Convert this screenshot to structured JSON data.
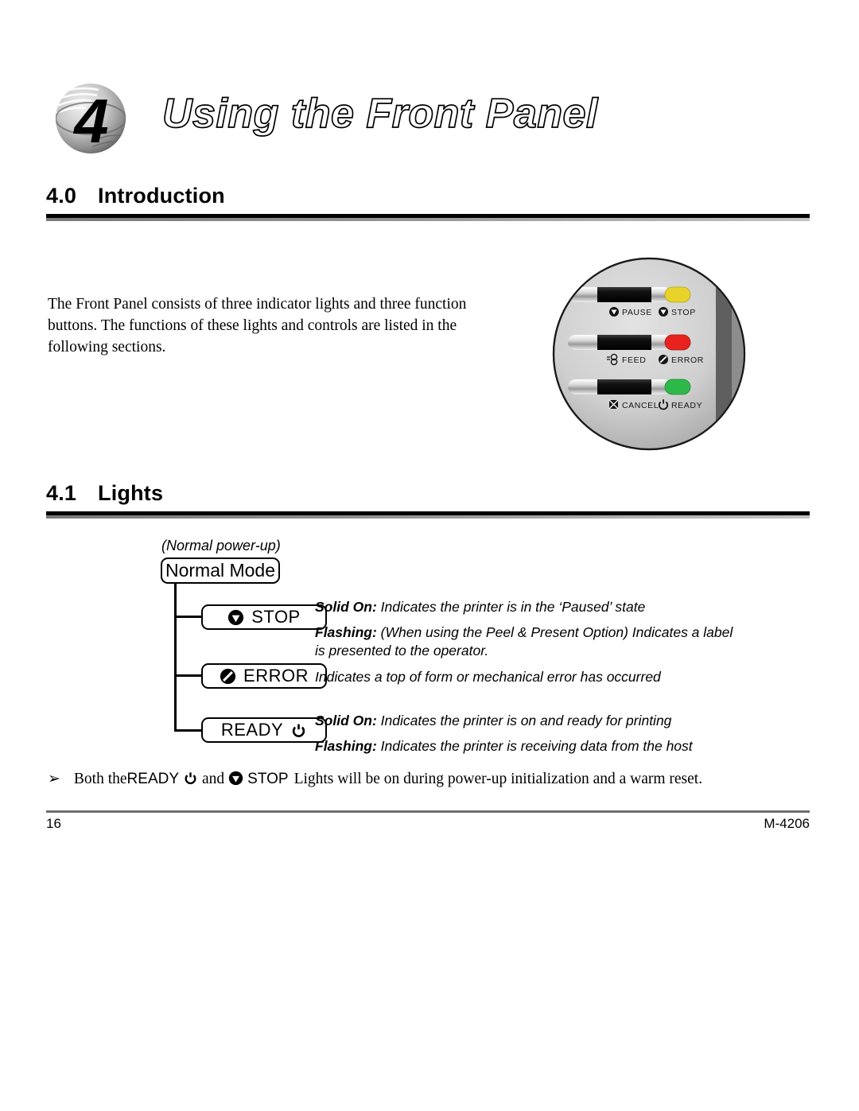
{
  "document": {
    "chapter_number": "4",
    "chapter_title": "Using the Front Panel"
  },
  "sections": {
    "intro": {
      "number": "4.0",
      "title": "Introduction",
      "body": "The Front Panel consists of three indicator lights and three function buttons.  The functions of these lights and controls are listed in the following sections."
    },
    "lights": {
      "number": "4.1",
      "title": "Lights"
    }
  },
  "panel_photo": {
    "buttons": [
      "PAUSE",
      "FEED",
      "CANCEL"
    ],
    "indicators": [
      {
        "label": "STOP",
        "color": "#e8d32a"
      },
      {
        "label": "ERROR",
        "color": "#e8231f"
      },
      {
        "label": "READY",
        "color": "#2fb84a"
      }
    ]
  },
  "diagram": {
    "mode_caption": "(Normal power-up)",
    "mode_label": "Normal Mode",
    "lights": [
      {
        "label": "STOP",
        "icon": "stop-triangle-icon",
        "icon_side": "left",
        "descriptions": [
          {
            "keyword": "Solid On:",
            "text": " Indicates the printer is in the ‘Paused’ state"
          },
          {
            "keyword": "Flashing:",
            "text": " (When using the Peel & Present Option) Indicates a label is presented to the operator."
          }
        ]
      },
      {
        "label": "ERROR",
        "icon": "error-slash-icon",
        "icon_side": "left",
        "descriptions": [
          {
            "keyword": "",
            "text": "Indicates a top of form or mechanical error has occurred"
          }
        ]
      },
      {
        "label": "READY",
        "icon": "ready-power-icon",
        "icon_side": "right",
        "descriptions": [
          {
            "keyword": "Solid On:",
            "text": " Indicates the printer is on and ready for printing"
          },
          {
            "keyword": "Flashing:",
            "text": " Indicates the printer is receiving data from the host"
          }
        ]
      }
    ]
  },
  "note": {
    "bullet": "➢",
    "part1": "Both the ",
    "ready_label": "READY",
    "part2": "and",
    "stop_label": "STOP",
    "part3": "Lights will be on during power-up initialization and a warm reset."
  },
  "footer": {
    "page_number": "16",
    "doc_id": "M-4206"
  },
  "colors": {
    "rule_black": "#000000",
    "rule_gray": "#8f8f8f",
    "footer_rule": "#6e6e6e"
  }
}
